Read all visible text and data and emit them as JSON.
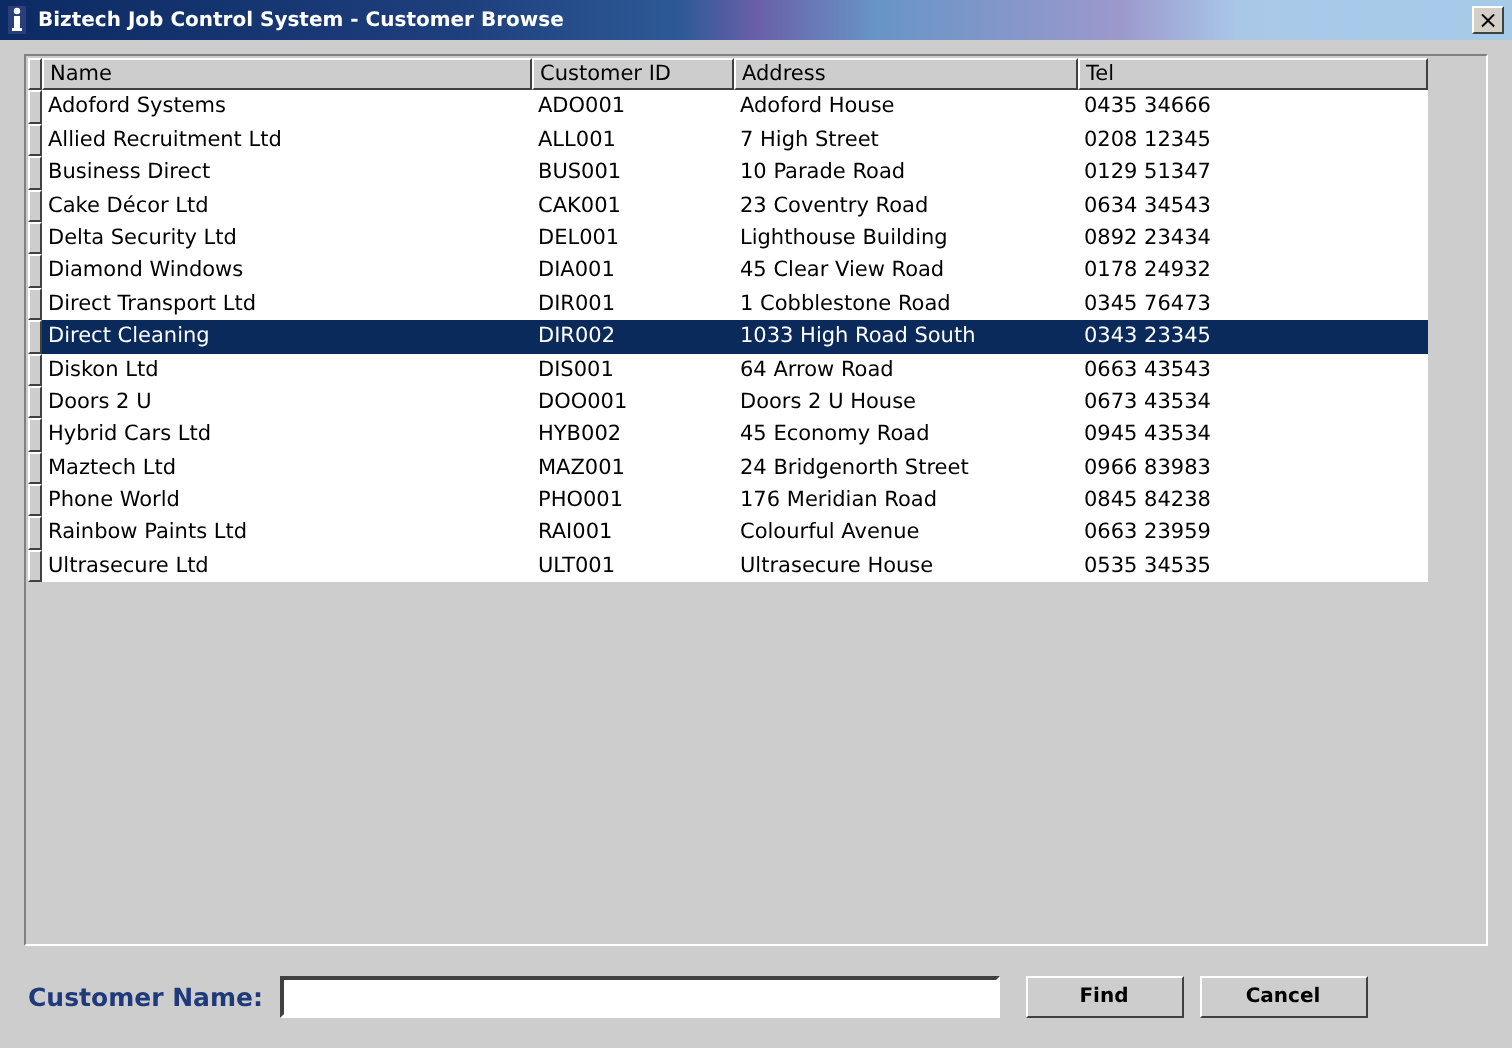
{
  "window": {
    "title": "Biztech Job Control System - Customer Browse",
    "close": "×"
  },
  "table": {
    "columns": [
      "Name",
      "Customer ID",
      "Address",
      "Tel"
    ],
    "rows": [
      {
        "cells": [
          "Adoford Systems",
          "ADO001",
          "Adoford House",
          "0435 34666"
        ],
        "selected": false
      },
      {
        "cells": [
          "Allied Recruitment Ltd",
          "ALL001",
          "7 High Street",
          "0208 12345"
        ],
        "selected": false
      },
      {
        "cells": [
          "Business Direct",
          "BUS001",
          "10 Parade Road",
          "0129 51347"
        ],
        "selected": false
      },
      {
        "cells": [
          "Cake Décor Ltd",
          "CAK001",
          "23 Coventry Road",
          "0634 34543"
        ],
        "selected": false
      },
      {
        "cells": [
          "Delta Security Ltd",
          "DEL001",
          "Lighthouse Building",
          "0892 23434"
        ],
        "selected": false
      },
      {
        "cells": [
          "Diamond Windows",
          "DIA001",
          "45 Clear View Road",
          "0178 24932"
        ],
        "selected": false
      },
      {
        "cells": [
          "Direct Transport Ltd",
          "DIR001",
          "1 Cobblestone Road",
          "0345 76473"
        ],
        "selected": false
      },
      {
        "cells": [
          "Direct Cleaning",
          "DIR002",
          "1033 High Road South",
          "0343 23345"
        ],
        "selected": true
      },
      {
        "cells": [
          "Diskon Ltd",
          "DIS001",
          "64 Arrow Road",
          "0663 43543"
        ],
        "selected": false
      },
      {
        "cells": [
          "Doors 2 U",
          "DOO001",
          "Doors 2 U House",
          "0673 43534"
        ],
        "selected": false
      },
      {
        "cells": [
          "Hybrid Cars Ltd",
          "HYB002",
          "45 Economy Road",
          "0945 43534"
        ],
        "selected": false
      },
      {
        "cells": [
          "Maztech Ltd",
          "MAZ001",
          "24 Bridgenorth Street",
          "0966 83983"
        ],
        "selected": false
      },
      {
        "cells": [
          "Phone World",
          "PHO001",
          "176 Meridian Road",
          "0845 84238"
        ],
        "selected": false
      },
      {
        "cells": [
          "Rainbow Paints Ltd",
          "RAI001",
          "Colourful Avenue",
          "0663 23959"
        ],
        "selected": false
      },
      {
        "cells": [
          "Ultrasecure Ltd",
          "ULT001",
          "Ultrasecure House",
          "0535 34535"
        ],
        "selected": false
      }
    ]
  },
  "search": {
    "label": "Customer Name:"
  },
  "buttons": [
    "Find",
    "Cancel"
  ]
}
